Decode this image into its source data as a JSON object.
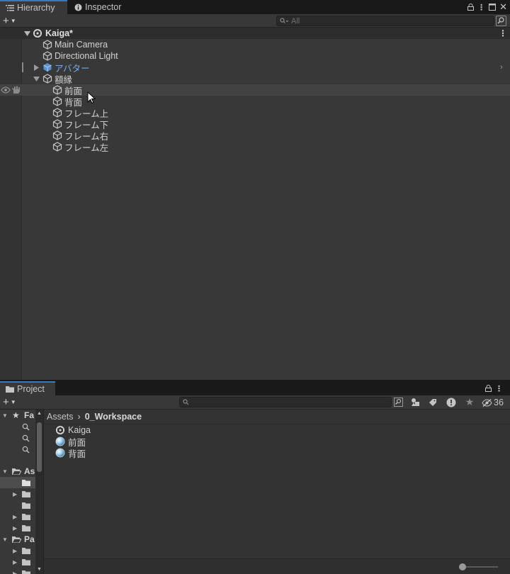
{
  "hierarchy": {
    "tab_label": "Hierarchy",
    "inspector_tab_label": "Inspector",
    "search_placeholder": "All",
    "rows": [
      {
        "label": "Kaiga*",
        "kind": "scene",
        "indent": 0,
        "expanded": true
      },
      {
        "label": "Main Camera",
        "kind": "object",
        "indent": 1
      },
      {
        "label": "Directional Light",
        "kind": "object",
        "indent": 1
      },
      {
        "label": "アバター",
        "kind": "prefab",
        "indent": 1,
        "expanded": false
      },
      {
        "label": "額縁",
        "kind": "object",
        "indent": 1,
        "expanded": true
      },
      {
        "label": "前面",
        "kind": "object",
        "indent": 2
      },
      {
        "label": "背面",
        "kind": "object",
        "indent": 2
      },
      {
        "label": "フレーム上",
        "kind": "object",
        "indent": 2
      },
      {
        "label": "フレーム下",
        "kind": "object",
        "indent": 2
      },
      {
        "label": "フレーム右",
        "kind": "object",
        "indent": 2
      },
      {
        "label": "フレーム左",
        "kind": "object",
        "indent": 2
      }
    ]
  },
  "project": {
    "tab_label": "Project",
    "search_placeholder": "",
    "hidden_count": "36",
    "breadcrumb": {
      "root": "Assets",
      "separator": "›",
      "current": "0_Workspace"
    },
    "tree": {
      "favorites_label": "Fa",
      "assets_label": "As",
      "packages_label": "Pa"
    },
    "files": [
      {
        "label": "Kaiga",
        "icon": "unity-scene-icon"
      },
      {
        "label": "前面",
        "icon": "material-icon"
      },
      {
        "label": "背面",
        "icon": "material-icon"
      }
    ]
  },
  "colors": {
    "panel_bg": "#383838",
    "prefab_text": "#7aa9e6",
    "active_tab_accent": "#3a79bb",
    "hover_row": "#424242"
  }
}
